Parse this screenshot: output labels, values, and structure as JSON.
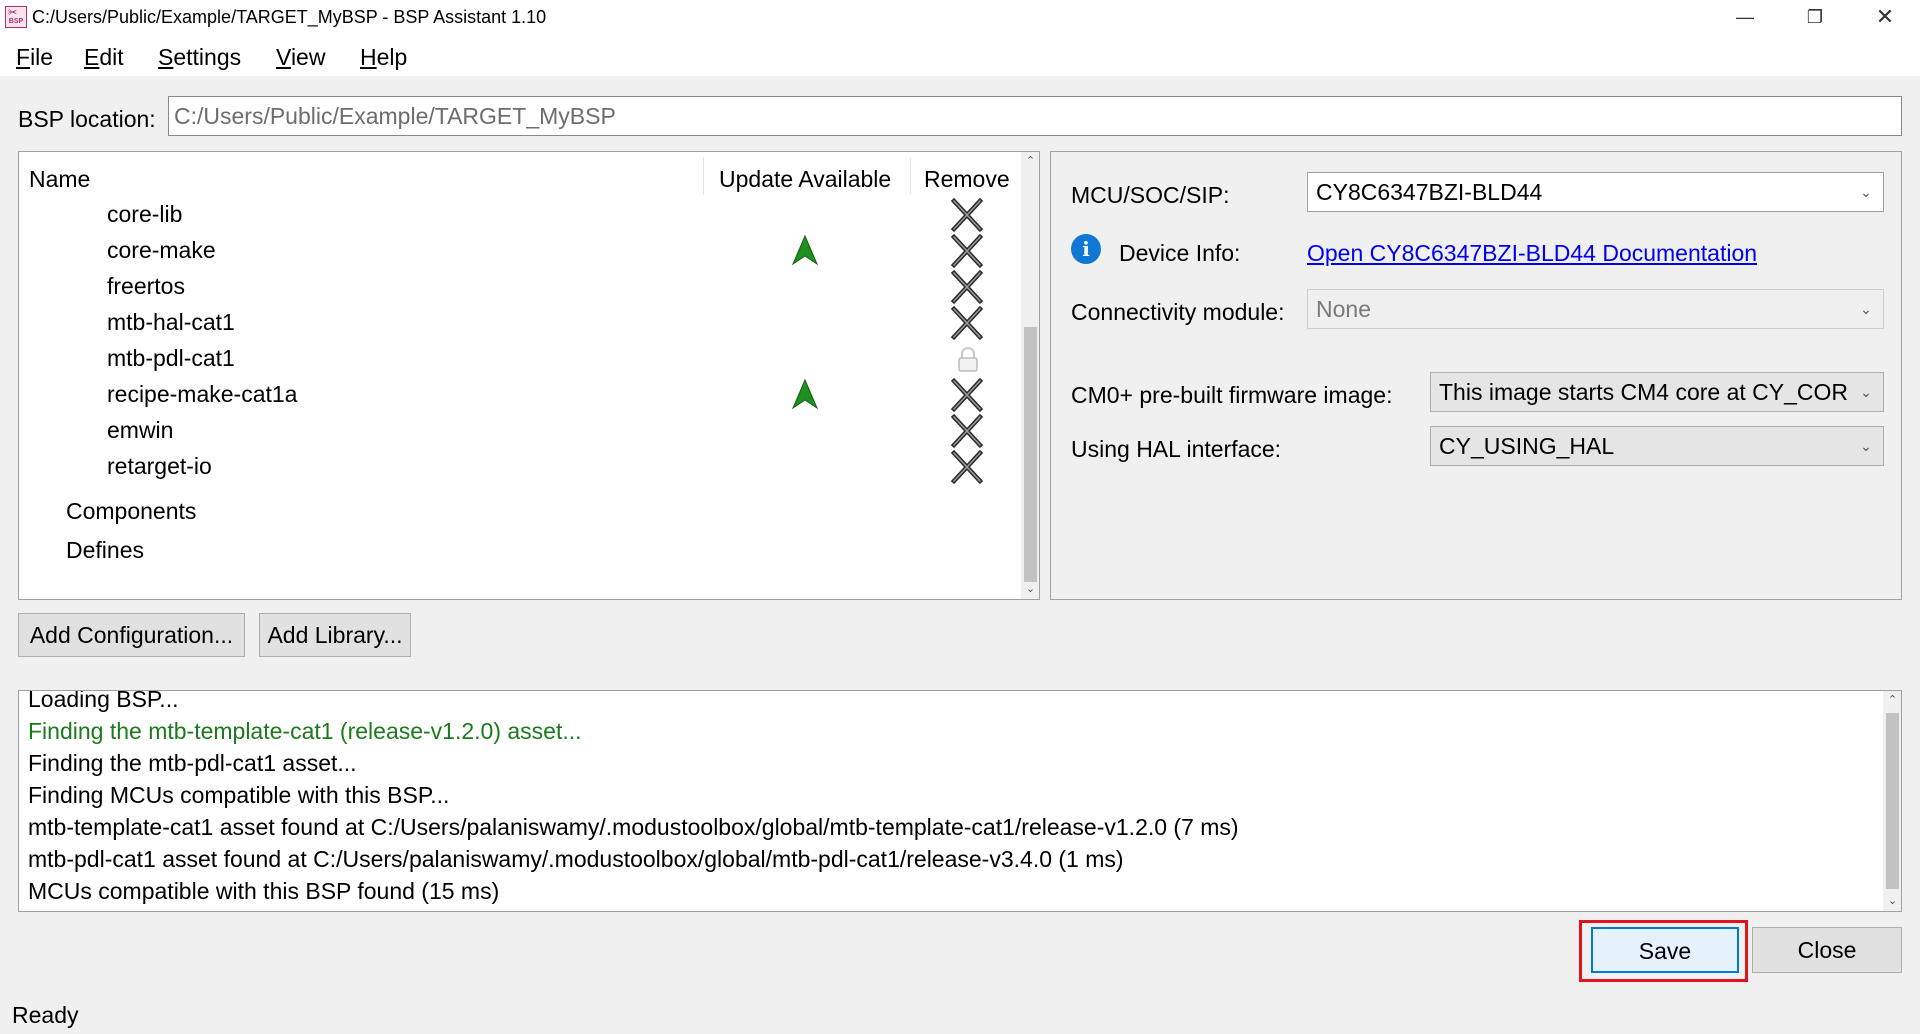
{
  "window": {
    "title": "C:/Users/Public/Example/TARGET_MyBSP - BSP Assistant 1.10",
    "app_icon_text": "BSP",
    "controls": {
      "minimize": "—",
      "maximize": "❐",
      "close": "✕"
    }
  },
  "menu": [
    {
      "key": "F",
      "rest": "ile"
    },
    {
      "key": "E",
      "rest": "dit"
    },
    {
      "key": "S",
      "rest": "ettings"
    },
    {
      "key": "V",
      "rest": "iew"
    },
    {
      "key": "H",
      "rest": "elp"
    }
  ],
  "bsp_location": {
    "label": "BSP location:",
    "value": "C:/Users/Public/Example/TARGET_MyBSP"
  },
  "tree": {
    "columns": {
      "name": "Name",
      "update": "Update Available",
      "remove": "Remove"
    },
    "libraries": [
      {
        "name": "core-lib",
        "update": false,
        "action": "remove"
      },
      {
        "name": "core-make",
        "update": true,
        "action": "remove"
      },
      {
        "name": "freertos",
        "update": false,
        "action": "remove"
      },
      {
        "name": "mtb-hal-cat1",
        "update": false,
        "action": "remove"
      },
      {
        "name": "mtb-pdl-cat1",
        "update": false,
        "action": "locked"
      },
      {
        "name": "recipe-make-cat1a",
        "update": true,
        "action": "remove"
      },
      {
        "name": "emwin",
        "update": false,
        "action": "remove"
      },
      {
        "name": "retarget-io",
        "update": false,
        "action": "remove"
      }
    ],
    "groups": [
      "Components",
      "Defines"
    ]
  },
  "buttons": {
    "add_configuration": "Add Configuration...",
    "add_library": "Add Library...",
    "save": "Save",
    "close": "Close"
  },
  "properties": {
    "mcu_label": "MCU/SOC/SIP:",
    "mcu_value": "CY8C6347BZI-BLD44",
    "device_info_label": "Device Info:",
    "device_info_link": "Open CY8C6347BZI-BLD44 Documentation",
    "connectivity_label": "Connectivity module:",
    "connectivity_value": "None",
    "cm0_label": "CM0+ pre-built firmware image:",
    "cm0_value": "This image starts CM4 core at CY_COR",
    "hal_label": "Using HAL interface:",
    "hal_value": "CY_USING_HAL"
  },
  "log": [
    {
      "text": "Loading BSP...",
      "green": false
    },
    {
      "text": "Finding the mtb-template-cat1 (release-v1.2.0) asset...",
      "green": true
    },
    {
      "text": "Finding the mtb-pdl-cat1 asset...",
      "green": false
    },
    {
      "text": "Finding MCUs compatible with this BSP...",
      "green": false
    },
    {
      "text": "mtb-template-cat1 asset found at C:/Users/palaniswamy/.modustoolbox/global/mtb-template-cat1/release-v1.2.0 (7 ms)",
      "green": false
    },
    {
      "text": "mtb-pdl-cat1 asset found at C:/Users/palaniswamy/.modustoolbox/global/mtb-pdl-cat1/release-v3.4.0 (1 ms)",
      "green": false
    },
    {
      "text": "MCUs compatible with this BSP found (15 ms)",
      "green": false
    }
  ],
  "status": "Ready",
  "colors": {
    "accent": "#0078d7",
    "highlight": "#e0141e",
    "update_arrow": "#1f8f1f",
    "log_green": "#1c7a1c",
    "link": "#0000ee"
  }
}
